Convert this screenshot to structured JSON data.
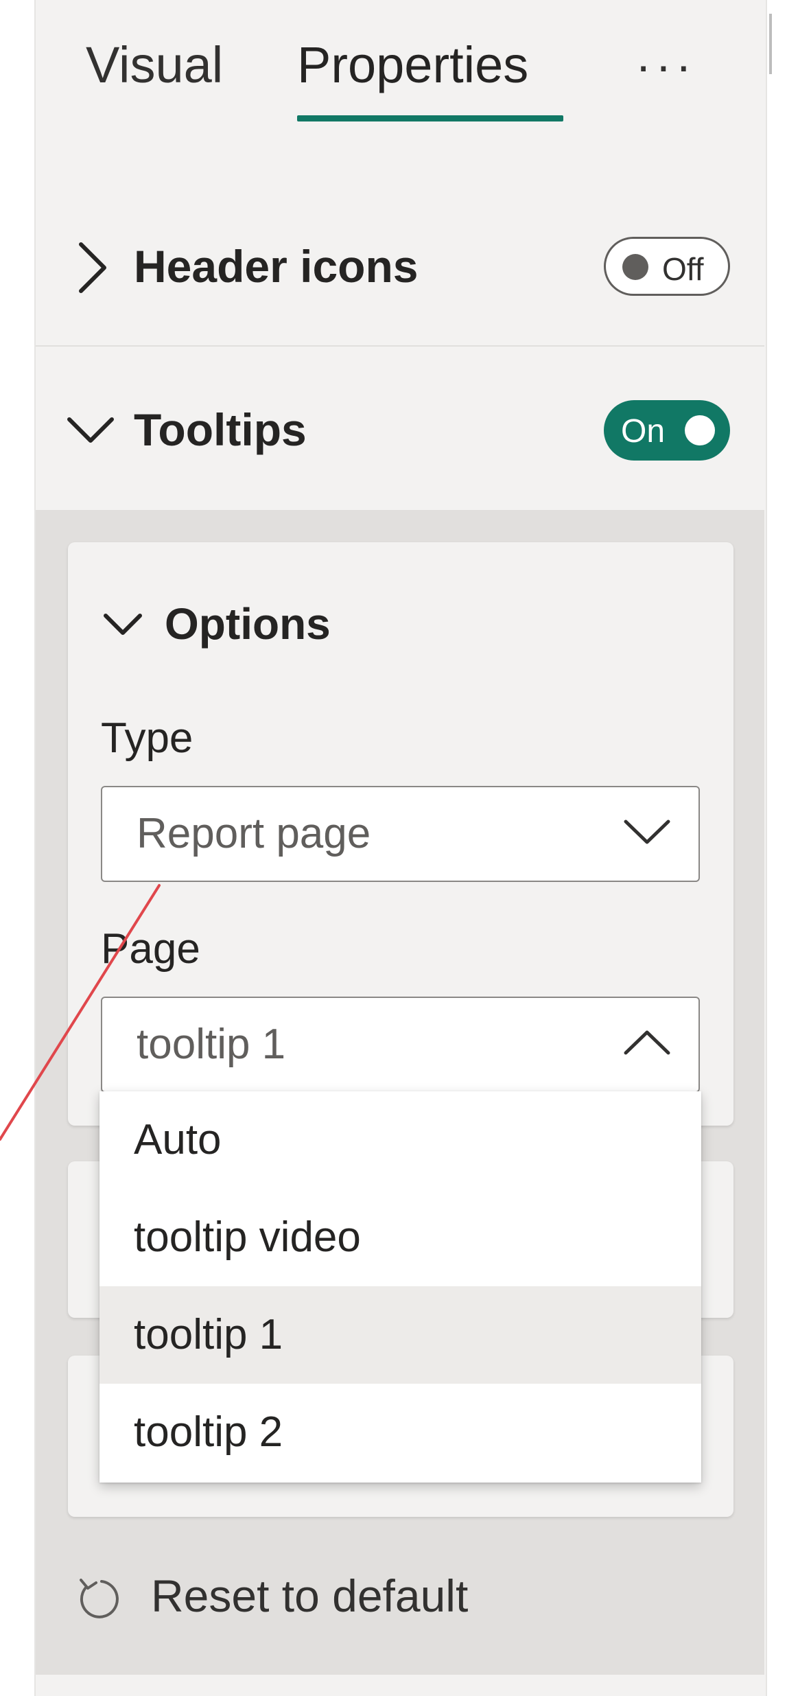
{
  "tabs": {
    "visual": "Visual",
    "properties": "Properties",
    "more": "···"
  },
  "header_icons": {
    "title": "Header icons",
    "toggle_label": "Off",
    "state": "off"
  },
  "tooltips": {
    "title": "Tooltips",
    "toggle_label": "On",
    "state": "on"
  },
  "options": {
    "title": "Options",
    "type_label": "Type",
    "type_value": "Report page",
    "page_label": "Page",
    "page_value": "tooltip 1",
    "page_options": [
      "Auto",
      "tooltip video",
      "tooltip 1",
      "tooltip 2"
    ],
    "selected_index": 2
  },
  "reset": {
    "label": "Reset to default"
  },
  "colors": {
    "accent": "#117865",
    "panel_bg": "#f3f2f1",
    "annotation_line": "#e0474c"
  }
}
